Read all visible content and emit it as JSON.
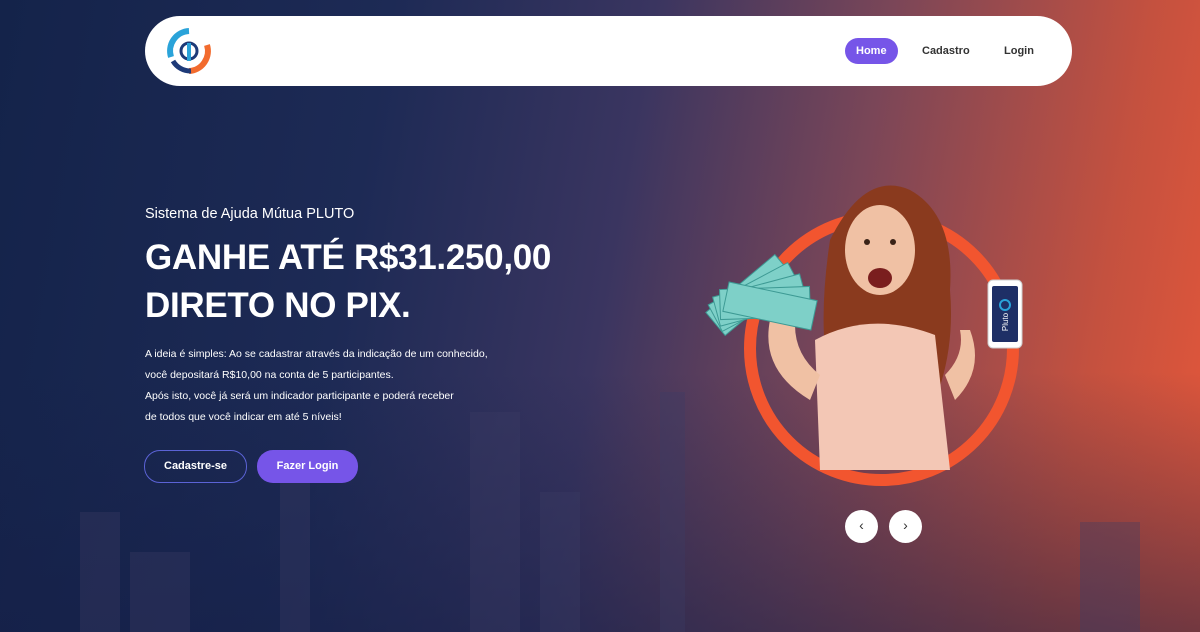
{
  "nav": {
    "logo_icon": "pluto-logo-icon",
    "items": [
      {
        "label": "Home",
        "active": true
      },
      {
        "label": "Cadastro",
        "active": false
      },
      {
        "label": "Login",
        "active": false
      }
    ]
  },
  "hero": {
    "subtitle": "Sistema de Ajuda Mútua PLUTO",
    "headline_line1": "GANHE ATÉ R$31.250,00",
    "headline_line2": "DIRETO NO PIX.",
    "desc_lines": [
      "A ideia é simples: Ao se cadastrar através da indicação de um conhecido,",
      "você depositará R$10,00 na conta de 5 participantes.",
      "Após isto, você já será um indicador participante e poderá receber",
      "de todos que você indicar em até 5 níveis!"
    ],
    "btn_register": "Cadastre-se",
    "btn_login": "Fazer Login",
    "phone_label": "Pluto"
  },
  "carousel": {
    "prev": "‹",
    "next": "›"
  },
  "colors": {
    "accent": "#7655e8",
    "ring": "#f2552f",
    "bg_left": "#14234a",
    "bg_right": "#e5573a"
  }
}
